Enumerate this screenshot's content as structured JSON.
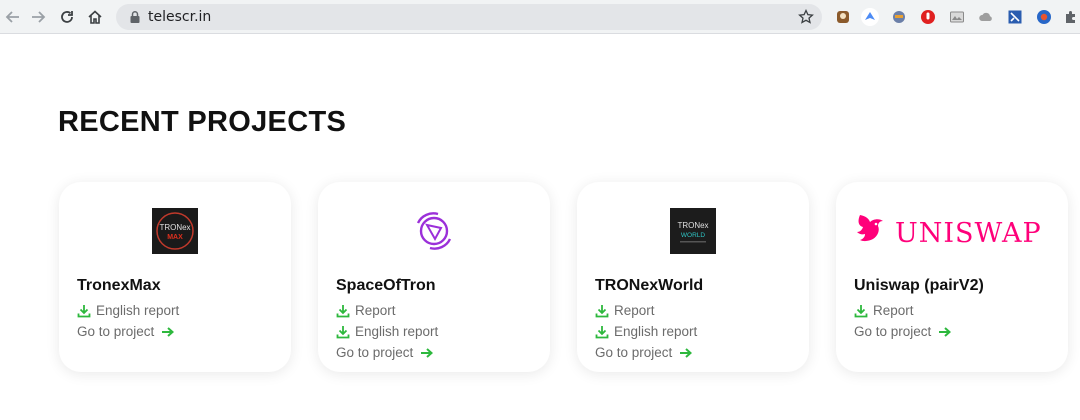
{
  "browser": {
    "url": "telescr.in",
    "icons": [
      "back-icon",
      "forward-icon",
      "reload-icon",
      "home-icon",
      "lock-icon",
      "star-icon"
    ],
    "extensions": [
      "ext-icon-1",
      "ext-icon-2",
      "ext-icon-3",
      "ext-icon-4",
      "ext-icon-5",
      "ext-icon-6",
      "ext-icon-7",
      "ext-icon-8",
      "puzzle-icon"
    ]
  },
  "page": {
    "title": "RECENT PROJECTS"
  },
  "projects": [
    {
      "name": "TronexMax",
      "logo_text": [
        "TRONex",
        "MAX"
      ],
      "links": [
        "English report",
        "Go to project"
      ]
    },
    {
      "name": "SpaceOfTron",
      "links": [
        "Report",
        "English report",
        "Go to project"
      ]
    },
    {
      "name": "TRONexWorld",
      "logo_text": [
        "TRONex",
        "WORLD"
      ],
      "links": [
        "Report",
        "English report",
        "Go to project"
      ]
    },
    {
      "name": "Uniswap (pairV2)",
      "logo_text": [
        "UNISWAP"
      ],
      "links": [
        "Report",
        "Go to project"
      ]
    }
  ],
  "colors": {
    "accent_green": "#2db83d",
    "spaceoftron_purple": "#9b30d9",
    "uniswap_pink": "#ff007a"
  }
}
